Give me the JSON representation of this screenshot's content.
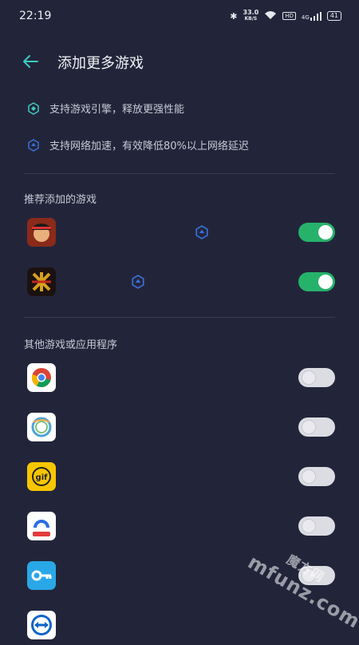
{
  "status_bar": {
    "time": "22:19",
    "speed_value": "33.0",
    "speed_unit": "KB/S",
    "hd_badge": "HD",
    "signal_label": "4G",
    "battery": "41"
  },
  "header": {
    "title": "添加更多游戏"
  },
  "features": [
    {
      "text": "支持游戏引擎，释放更强性能",
      "icon": "engine-icon"
    },
    {
      "text": "支持网络加速，有效降低80%以上网络延迟",
      "icon": "network-accel-icon"
    }
  ],
  "recommended": {
    "label": "推荐添加的游戏",
    "apps": [
      {
        "icon": "one-piece-game-icon",
        "enabled": true,
        "badge": "network-accel-icon"
      },
      {
        "icon": "sanguosha-game-icon",
        "enabled": true,
        "badge": "network-accel-icon"
      }
    ]
  },
  "others": {
    "label": "其他游戏或应用程序",
    "apps": [
      {
        "icon": "chrome-icon",
        "enabled": false
      },
      {
        "icon": "ring-app-icon",
        "enabled": false
      },
      {
        "icon": "gif-app-icon",
        "enabled": false
      },
      {
        "icon": "browser-app-icon",
        "enabled": false
      },
      {
        "icon": "key-app-icon",
        "enabled": false
      },
      {
        "icon": "teamviewer-icon",
        "enabled": false
      }
    ]
  },
  "watermark": {
    "text": "mfunz.com",
    "logo_text": "魔方网"
  },
  "colors": {
    "background": "#22253a",
    "toggle_on": "#27b26b",
    "toggle_off": "#dcdde3",
    "accent_teal": "#3cc9c0",
    "badge_blue": "#3b6fd8"
  }
}
